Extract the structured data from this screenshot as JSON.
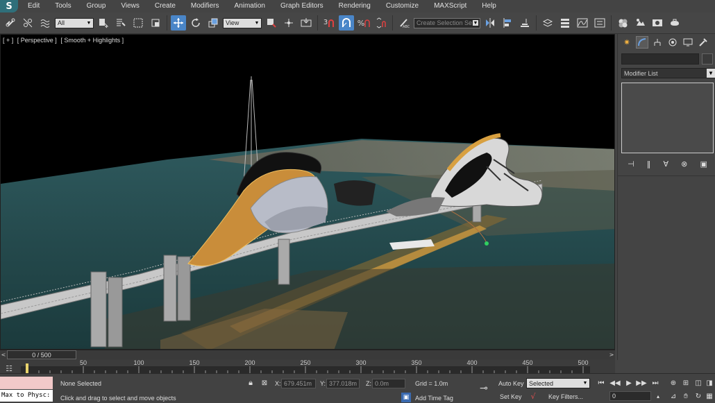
{
  "app": {
    "logo_letter": "S"
  },
  "menu": [
    "Edit",
    "Tools",
    "Group",
    "Views",
    "Create",
    "Modifiers",
    "Animation",
    "Graph Editors",
    "Rendering",
    "Customize",
    "MAXScript",
    "Help"
  ],
  "toolbar": {
    "filter_value": "All",
    "ref_coord_value": "View",
    "snap_value": "3",
    "named_selection_placeholder": "Create Selection Se"
  },
  "viewport": {
    "label_plus": "[ + ]",
    "label_view": "[ Perspective ]",
    "label_shading": "[ Smooth + Highlights ]"
  },
  "command_panel": {
    "modifier_list_label": "Modifier List"
  },
  "timeline": {
    "frame_display": "0 / 500",
    "ticks": [
      "50",
      "100",
      "150",
      "200",
      "250",
      "300",
      "350",
      "400",
      "450",
      "500"
    ],
    "prev_arrow": "<",
    "next_arrow": ">"
  },
  "status": {
    "listener_text": "Max to Physc:",
    "selection_status": "None Selected",
    "prompt": "Click and drag to select and move objects",
    "x_label": "X:",
    "x_value": "679.451m",
    "y_label": "Y:",
    "y_value": "377.018m",
    "z_label": "Z:",
    "z_value": "0.0m",
    "grid": "Grid = 1.0m",
    "add_time_tag": "Add Time Tag",
    "auto_key": "Auto Key",
    "set_key": "Set Key",
    "key_mode_value": "Selected",
    "key_filters": "Key Filters...",
    "current_frame": "0"
  }
}
